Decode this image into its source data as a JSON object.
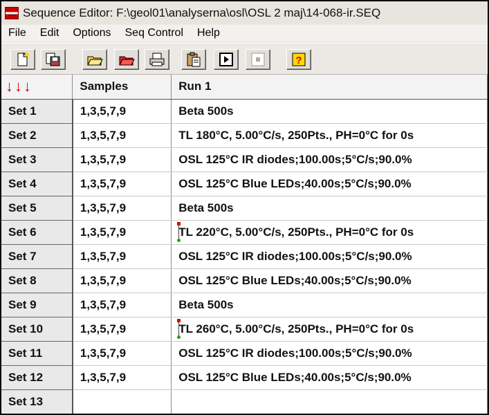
{
  "window": {
    "title": "Sequence Editor: F:\\geol01\\analyserna\\osl\\OSL 2 maj\\14-068-ir.SEQ"
  },
  "menu": [
    "File",
    "Edit",
    "Options",
    "Seq Control",
    "Help"
  ],
  "toolbar": {
    "buttons": [
      {
        "name": "new-icon"
      },
      {
        "name": "save-icon"
      },
      {
        "name": "open-icon"
      },
      {
        "name": "open-red-icon"
      },
      {
        "name": "print-icon"
      },
      {
        "name": "clipboard-icon"
      },
      {
        "name": "run-icon"
      },
      {
        "name": "stop-icon"
      },
      {
        "name": "help-icon"
      }
    ]
  },
  "grid": {
    "corner_label": "↓↓↓",
    "columns": [
      "Samples",
      "Run 1"
    ],
    "rows": [
      {
        "set": "Set 1",
        "samples": "1,3,5,7,9",
        "run": "Beta 500s"
      },
      {
        "set": "Set 2",
        "samples": "1,3,5,7,9",
        "run": "TL 180°C, 5.00°C/s, 250Pts., PH=0°C for 0s"
      },
      {
        "set": "Set 3",
        "samples": "1,3,5,7,9",
        "run": "OSL 125°C IR diodes;100.00s;5°C/s;90.0%"
      },
      {
        "set": "Set 4",
        "samples": "1,3,5,7,9",
        "run": "OSL 125°C Blue LEDs;40.00s;5°C/s;90.0%"
      },
      {
        "set": "Set 5",
        "samples": "1,3,5,7,9",
        "run": "Beta 500s"
      },
      {
        "set": "Set 6",
        "samples": "1,3,5,7,9",
        "run": "TL 220°C, 5.00°C/s, 250Pts., PH=0°C for 0s"
      },
      {
        "set": "Set 7",
        "samples": "1,3,5,7,9",
        "run": "OSL 125°C IR diodes;100.00s;5°C/s;90.0%"
      },
      {
        "set": "Set 8",
        "samples": "1,3,5,7,9",
        "run": "OSL 125°C Blue LEDs;40.00s;5°C/s;90.0%"
      },
      {
        "set": "Set 9",
        "samples": "1,3,5,7,9",
        "run": "Beta 500s"
      },
      {
        "set": "Set 10",
        "samples": "1,3,5,7,9",
        "run": "TL 260°C, 5.00°C/s, 250Pts., PH=0°C for 0s"
      },
      {
        "set": "Set 11",
        "samples": "1,3,5,7,9",
        "run": "OSL 125°C IR diodes;100.00s;5°C/s;90.0%"
      },
      {
        "set": "Set 12",
        "samples": "1,3,5,7,9",
        "run": "OSL 125°C Blue LEDs;40.00s;5°C/s;90.0%"
      },
      {
        "set": "Set 13",
        "samples": "",
        "run": ""
      }
    ]
  }
}
